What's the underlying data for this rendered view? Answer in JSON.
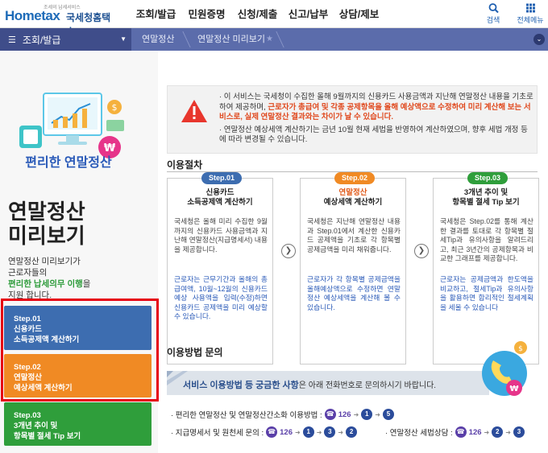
{
  "header": {
    "logo_slogan": "조세의 납세서비스",
    "logo_brand": "Hometax",
    "logo_sub": "국세청홈택스",
    "gnb": [
      "조회/발급",
      "민원증명",
      "신청/제출",
      "신고/납부",
      "상담/제보"
    ],
    "search_label": "검색",
    "allmenu_label": "전체메뉴"
  },
  "navbar": {
    "menu_label": "조회/발급",
    "crumbs": [
      "연말정산",
      "연말정산 미리보기"
    ]
  },
  "left": {
    "illus_title": "편리한 연말정산",
    "title_line1": "연말정산",
    "title_line2": "미리보기",
    "desc_1": "연말정산 미리보기가",
    "desc_2": "근로자들의",
    "desc_3_green": "편리한 납세의무 이행",
    "desc_3_rest": "을",
    "desc_4": "지원 합니다.",
    "steps": [
      {
        "step": "Step.01",
        "line1": "신용카드",
        "line2": "소득공제액 계산하기"
      },
      {
        "step": "Step.02",
        "line1": "연말정산",
        "line2": "예상세액 계산하기"
      },
      {
        "step": "Step.03",
        "line1": "3개년 추이 및",
        "line2": "항목별 절세 Tip 보기"
      }
    ]
  },
  "notice": {
    "p1_a": "· 이 서비스는 국세청이 수집한 올해 9월까지의 신용카드 사용금액과 지난해 연말정산 내용을 기초로 하여 제공하며, ",
    "p1_red": "근로자가 총급여 및 각종 공제항목을 올해 예상액으로 수정하여 미리 계산해 보는 서비스로, 실제 연말정산 결과와는 차이가 날 수 있습니다.",
    "p2": "· 연말정산 예상세액 계산하기는 금년 10월 현재 세법을 반영하여 계산하였으며, 향후 세법 개정 등에 따라 변경될 수 있습니다."
  },
  "procedure": {
    "title": "이용절차",
    "cards": [
      {
        "badge": "Step.01",
        "title1": "신용카드",
        "title2": "소득공제액 계산하기",
        "body": "국세청은 올해 미리 수집한 9월까지의 신용카드 사용금액과 지난해 연말정산(지급명세서) 내용을 제공합니다.",
        "highlight": "근로자는 근무기간과 올해의 총급여액, 10월~12월의 신용카드 예상 사용액을 입력(수정)하면 신용카드 공제액을 미리 예상할 수 있습니다."
      },
      {
        "badge": "Step.02",
        "title1": "연말정산",
        "title2": "예상세액 계산하기",
        "body": "국세청은 지난해 연말정산 내용과 Step.01에서 계산한 신용카드 공제액을 기초로 각 항목별 공제금액을 미리 채워줍니다.",
        "highlight": "근로자가 각 항목별 공제금액을 올해예상액으로 수정하면 연말정산 예상세액을 계산해 볼 수 있습니다."
      },
      {
        "badge": "Step.03",
        "title1": "3개년 추이 및",
        "title2": "항목별 절세 Tip 보기",
        "body": "국세청은 Step.02를 통해 계산한 결과를 토대로 각 항목별 절세Tip과 유의사항을 알려드리고, 최근 3년간의 공제항목과 비교한 그래프를 제공합니다.",
        "highlight": "근로자는 공제금액과 한도액을 비교하고, 절세Tip과 유의사항을 활용하면 합리적인 절세계획을 세울 수 있습니다"
      }
    ]
  },
  "inquiry": {
    "title": "이용방법 문의",
    "banner_bold": "서비스 이용방법 등 궁금한 사항",
    "banner_rest": "은 아래 전화번호로 문의하시기 바랍니다.",
    "line1_label": "· 편리한 연말정산 및 연말정산간소화 이용방법 :",
    "line1_code": "126",
    "line1_nums": [
      "1",
      "5"
    ],
    "line2_label": "· 지급명세서 및 원천세 문의 :",
    "line2_code": "126",
    "line2_nums": [
      "1",
      "3",
      "2"
    ],
    "line3_label": "· 연말정산 세법상담 :",
    "line3_code": "126",
    "line3_nums": [
      "2",
      "3"
    ]
  },
  "colors": {
    "step1": "#3d6db0",
    "step2": "#f08a24",
    "step3": "#2f9e3b",
    "nav": "#5b6cab"
  }
}
